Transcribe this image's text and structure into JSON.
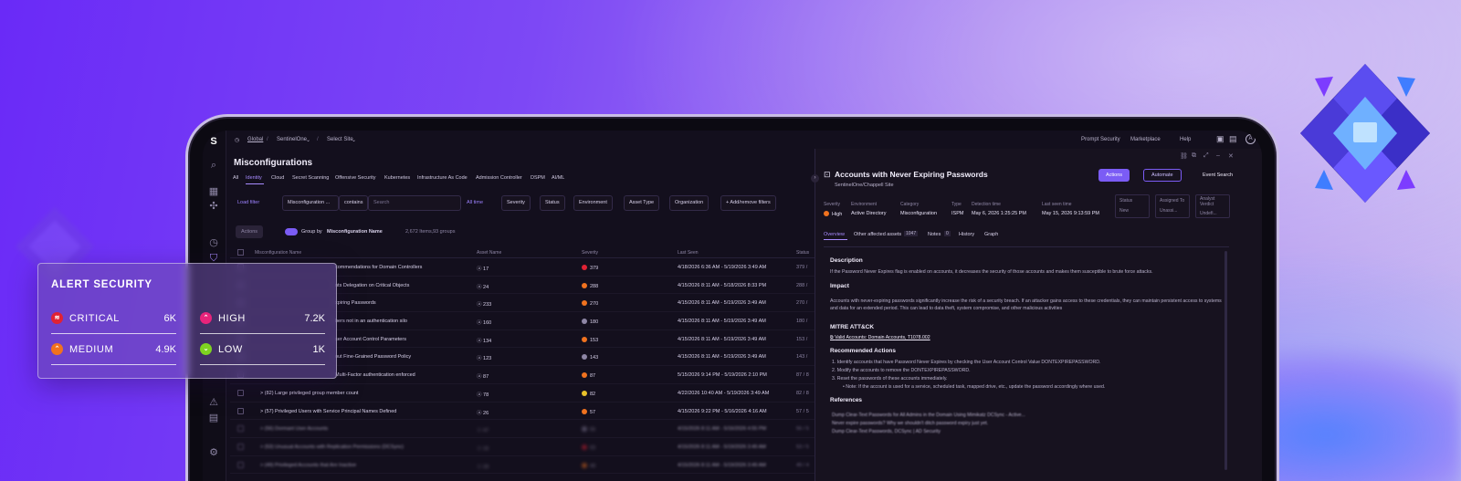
{
  "colors": {
    "critical": "#e02234",
    "high": "#e8247b",
    "medium": "#f0721f",
    "low": "#7ed321",
    "accent": "#7b5cf5"
  },
  "topbar": {
    "global": "Global",
    "account": "SentinelOne",
    "site": "Select Site",
    "prompt_security": "Prompt Security",
    "marketplace": "Marketplace",
    "help": "Help",
    "avatar": "A"
  },
  "page_title": "Misconfigurations",
  "tabs": [
    "All",
    "Identity",
    "Cloud",
    "Secret Scanning",
    "Offensive Security",
    "Kubernetes",
    "Infrastructure As Code",
    "Admission Controller",
    "DSPM",
    "AI/ML"
  ],
  "filters": {
    "load_filter": "Load filter",
    "field": "Misconfiguration ...",
    "operator": "contains",
    "search_placeholder": "Search",
    "time": "All time",
    "severity": "Severity",
    "status": "Status",
    "environment": "Environment",
    "asset_type": "Asset Type",
    "organization": "Organization",
    "add_remove": "+ Add/remove filters"
  },
  "groupbar": {
    "actions": "Actions",
    "group_by": "Group by",
    "group_field": "Misconfiguration Name",
    "items": "2,672 Items,",
    "groups": "93 groups"
  },
  "table": {
    "columns": [
      "Misconfiguration Name",
      "Asset Name",
      "Severity",
      "Last Seen",
      "Status"
    ],
    "rows": [
      {
        "name": "commendations for Domain Controllers",
        "asset": "17",
        "severity": "379",
        "last_seen": "4/18/2026 6:36 AM - 5/19/2026 3:49 AM",
        "status": "379 /",
        "color": "#e02234"
      },
      {
        "name": "nts Delegation on Critical Objects",
        "asset": "24",
        "severity": "288",
        "last_seen": "4/15/2026 8:11 AM - 5/18/2026 8:33 PM",
        "status": "288 /",
        "color": "#f0721f"
      },
      {
        "name": "xpiring Passwords",
        "asset": "233",
        "severity": "270",
        "last_seen": "4/15/2026 8:11 AM - 5/19/2026 3:49 AM",
        "status": "270 /",
        "color": "#f0721f"
      },
      {
        "name": "bers not in an authentication silo",
        "asset": "160",
        "severity": "180",
        "last_seen": "4/15/2026 8:11 AM - 5/19/2026 3:49 AM",
        "status": "180 /",
        "color": "#8e86a5"
      },
      {
        "name": "ser Account Control Parameters",
        "asset": "134",
        "severity": "153",
        "last_seen": "4/15/2026 8:11 AM - 5/19/2026 3:49 AM",
        "status": "153 /",
        "color": "#f0721f"
      },
      {
        "name": "out Fine-Grained Password Policy",
        "asset": "123",
        "severity": "143",
        "last_seen": "4/15/2026 8:11 AM - 5/19/2026 3:49 AM",
        "status": "143 /",
        "color": "#8e86a5"
      },
      {
        "name": "Multi-Factor authentication enforced",
        "asset": "87",
        "severity": "87",
        "last_seen": "5/15/2026 9:14 PM - 5/19/2026 2:10 PM",
        "status": "87 / 8",
        "color": "#f0721f"
      },
      {
        "name": "> (82)  Large privileged group member count",
        "asset": "78",
        "severity": "82",
        "last_seen": "4/22/2026 10:40 AM - 5/19/2026 3:49 AM",
        "status": "82 / 8",
        "color": "#e8c12a"
      },
      {
        "name": "> (57)  Privileged Users with Service Principal Names Defined",
        "asset": "26",
        "severity": "57",
        "last_seen": "4/15/2026 9:22 PM - 5/16/2026 4:16 AM",
        "status": "57 / 5",
        "color": "#f0721f"
      },
      {
        "name": "> (56)  Dormant User Accounts",
        "asset": "47",
        "severity": "56",
        "last_seen": "4/15/2026 8:11 AM - 5/16/2026 4:55 PM",
        "status": "56 / 5",
        "color": "#8e86a5"
      },
      {
        "name": "> (53)  Unusual Accounts with Replication Permissions (DCSync)",
        "asset": "15",
        "severity": "53",
        "last_seen": "4/15/2026 8:11 AM - 5/19/2026 3:49 AM",
        "status": "53 / 5",
        "color": "#e02234"
      },
      {
        "name": "> (49)  Privileged Accounts that Are Inactive",
        "asset": "29",
        "severity": "49",
        "last_seen": "4/15/2026 8:11 AM - 5/19/2026 3:49 AM",
        "status": "49 / 4",
        "color": "#f0721f"
      }
    ]
  },
  "detail": {
    "title": "Accounts with Never Expiring Passwords",
    "subtitle": "SentinelOne/Chappell Site",
    "actions": "Actions",
    "automate": "Automate",
    "event_search": "Event Search",
    "fields": [
      {
        "label": "Severity",
        "value": "High"
      },
      {
        "label": "Environment",
        "value": "Active Directory"
      },
      {
        "label": "Category",
        "value": "Misconfiguration"
      },
      {
        "label": "Type",
        "value": "ISPM"
      },
      {
        "label": "Detection time",
        "value": "May 6, 2026 1:25:25 PM"
      },
      {
        "label": "Last seen time",
        "value": "May 15, 2026 9:13:59 PM"
      }
    ],
    "status_label": "Status",
    "status_value": "New",
    "assigned_label": "Assigned To",
    "assigned_value": "Unassi...",
    "verdict_label": "Analyst Verdict",
    "verdict_value": "Undefi...",
    "tabs": [
      "Overview",
      "Other affected assets",
      "Notes",
      "History",
      "Graph"
    ],
    "tab_counts": {
      "assets": "1047",
      "notes": "0"
    },
    "description_h": "Description",
    "description": "If the Password Never Expires flag is enabled on accounts, it decreases the security of those accounts and makes them susceptible to brute force attacks.",
    "impact_h": "Impact",
    "impact": "Accounts with never-expiring passwords significantly increase the risk of a security breach. If an attacker gains access to these credentials, they can maintain persistent access to systems and data for an extended period. This can lead to data theft, system compromise, and other malicious activities",
    "mitre_h": "MITRE ATT&CK",
    "mitre_link": "Valid Accounts: Domain Accounts, T1078.002",
    "recommended_h": "Recommended Actions",
    "recommended": [
      "1. Identify accounts that have Password Never Expires by checking the User Account Control Value DONTEXPIREPASSWORD.",
      "2. Modify the accounts to remove the DONTEXPIREPASSWORD.",
      "3. Reset the passwords of these accounts immediately.",
      "• Note: If the account is used for a service, scheduled task, mapped drive, etc., update the password accordingly where used."
    ],
    "references_h": "References",
    "references": [
      "Dump Clear-Text Passwords for All Admins in the Domain Using Mimikatz DCSync - Active...",
      "Never expire passwords? Why we shouldn't ditch password expiry just yet.",
      "Dump Clear-Text Passwords, DCSync | AD Security"
    ]
  },
  "alert_card": {
    "title": "ALERT SECURITY",
    "items": [
      {
        "label": "CRITICAL",
        "value": "6K",
        "icon": "critical-icon"
      },
      {
        "label": "HIGH",
        "value": "7.2K",
        "icon": "high-icon"
      },
      {
        "label": "MEDIUM",
        "value": "4.9K",
        "icon": "medium-icon"
      },
      {
        "label": "LOW",
        "value": "1K",
        "icon": "low-icon"
      }
    ]
  }
}
